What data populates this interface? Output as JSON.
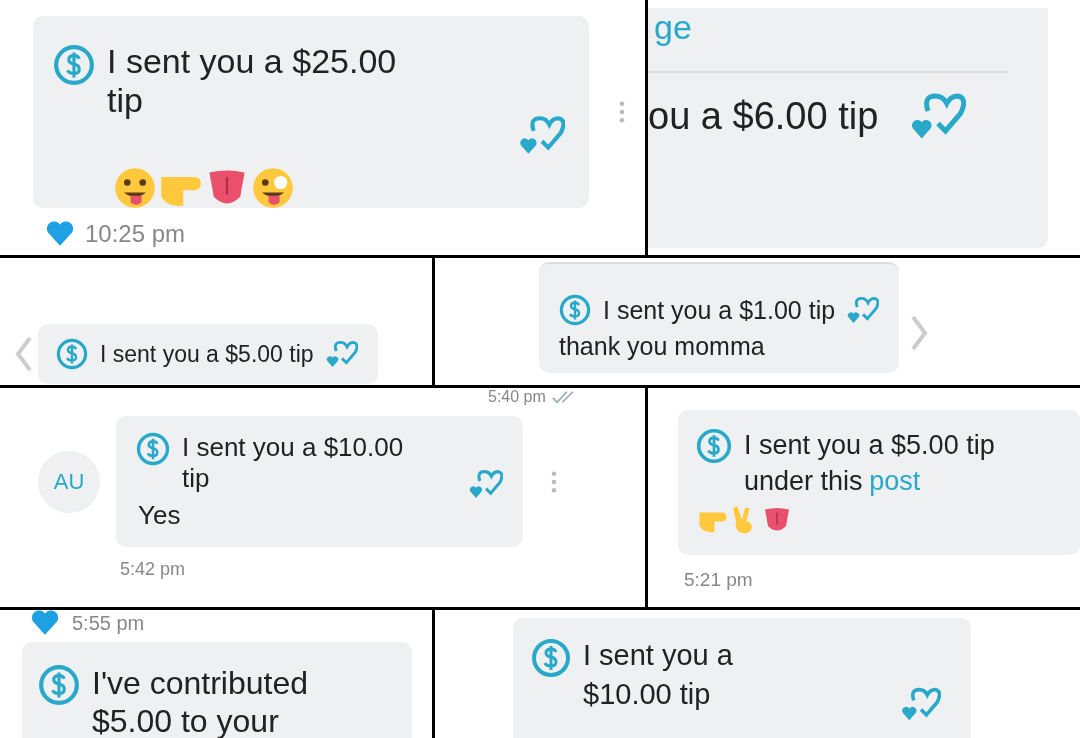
{
  "rows": [
    {
      "panels": [
        {
          "tip": "I sent you a $25.00 tip",
          "emojis": [
            {
              "kind": "tongue-face"
            },
            {
              "kind": "pointing-hand"
            },
            {
              "kind": "tongue"
            },
            {
              "kind": "zany-face"
            }
          ],
          "time": "10:25 pm",
          "liked": true,
          "menu": true
        },
        {
          "header": "ge",
          "tip": "ou a $6.00 tip"
        }
      ]
    },
    {
      "panels": [
        {
          "tip": "I sent you a $5.00 tip",
          "prev_arrow": true
        },
        {
          "tip": "I sent you a $1.00 tip",
          "caption": "thank you momma",
          "next_arrow": true
        }
      ]
    },
    {
      "panels": [
        {
          "top_time": "5:40 pm",
          "avatar": "AU",
          "tip": "I sent you a $10.00 tip",
          "caption": "Yes",
          "time": "5:42 pm",
          "menu": true
        },
        {
          "tip": "I sent you a $5.00 tip under this",
          "link": "post",
          "emojis": [
            {
              "kind": "pointing-hand"
            },
            {
              "kind": "victory-hand"
            },
            {
              "kind": "tongue"
            }
          ],
          "time": "5:21 pm"
        }
      ]
    },
    {
      "panels": [
        {
          "top_time": "5:55 pm",
          "liked": true,
          "tip": "I've contributed $5.00 to your"
        },
        {
          "tip": "I sent you a $10.00 tip"
        }
      ]
    }
  ]
}
